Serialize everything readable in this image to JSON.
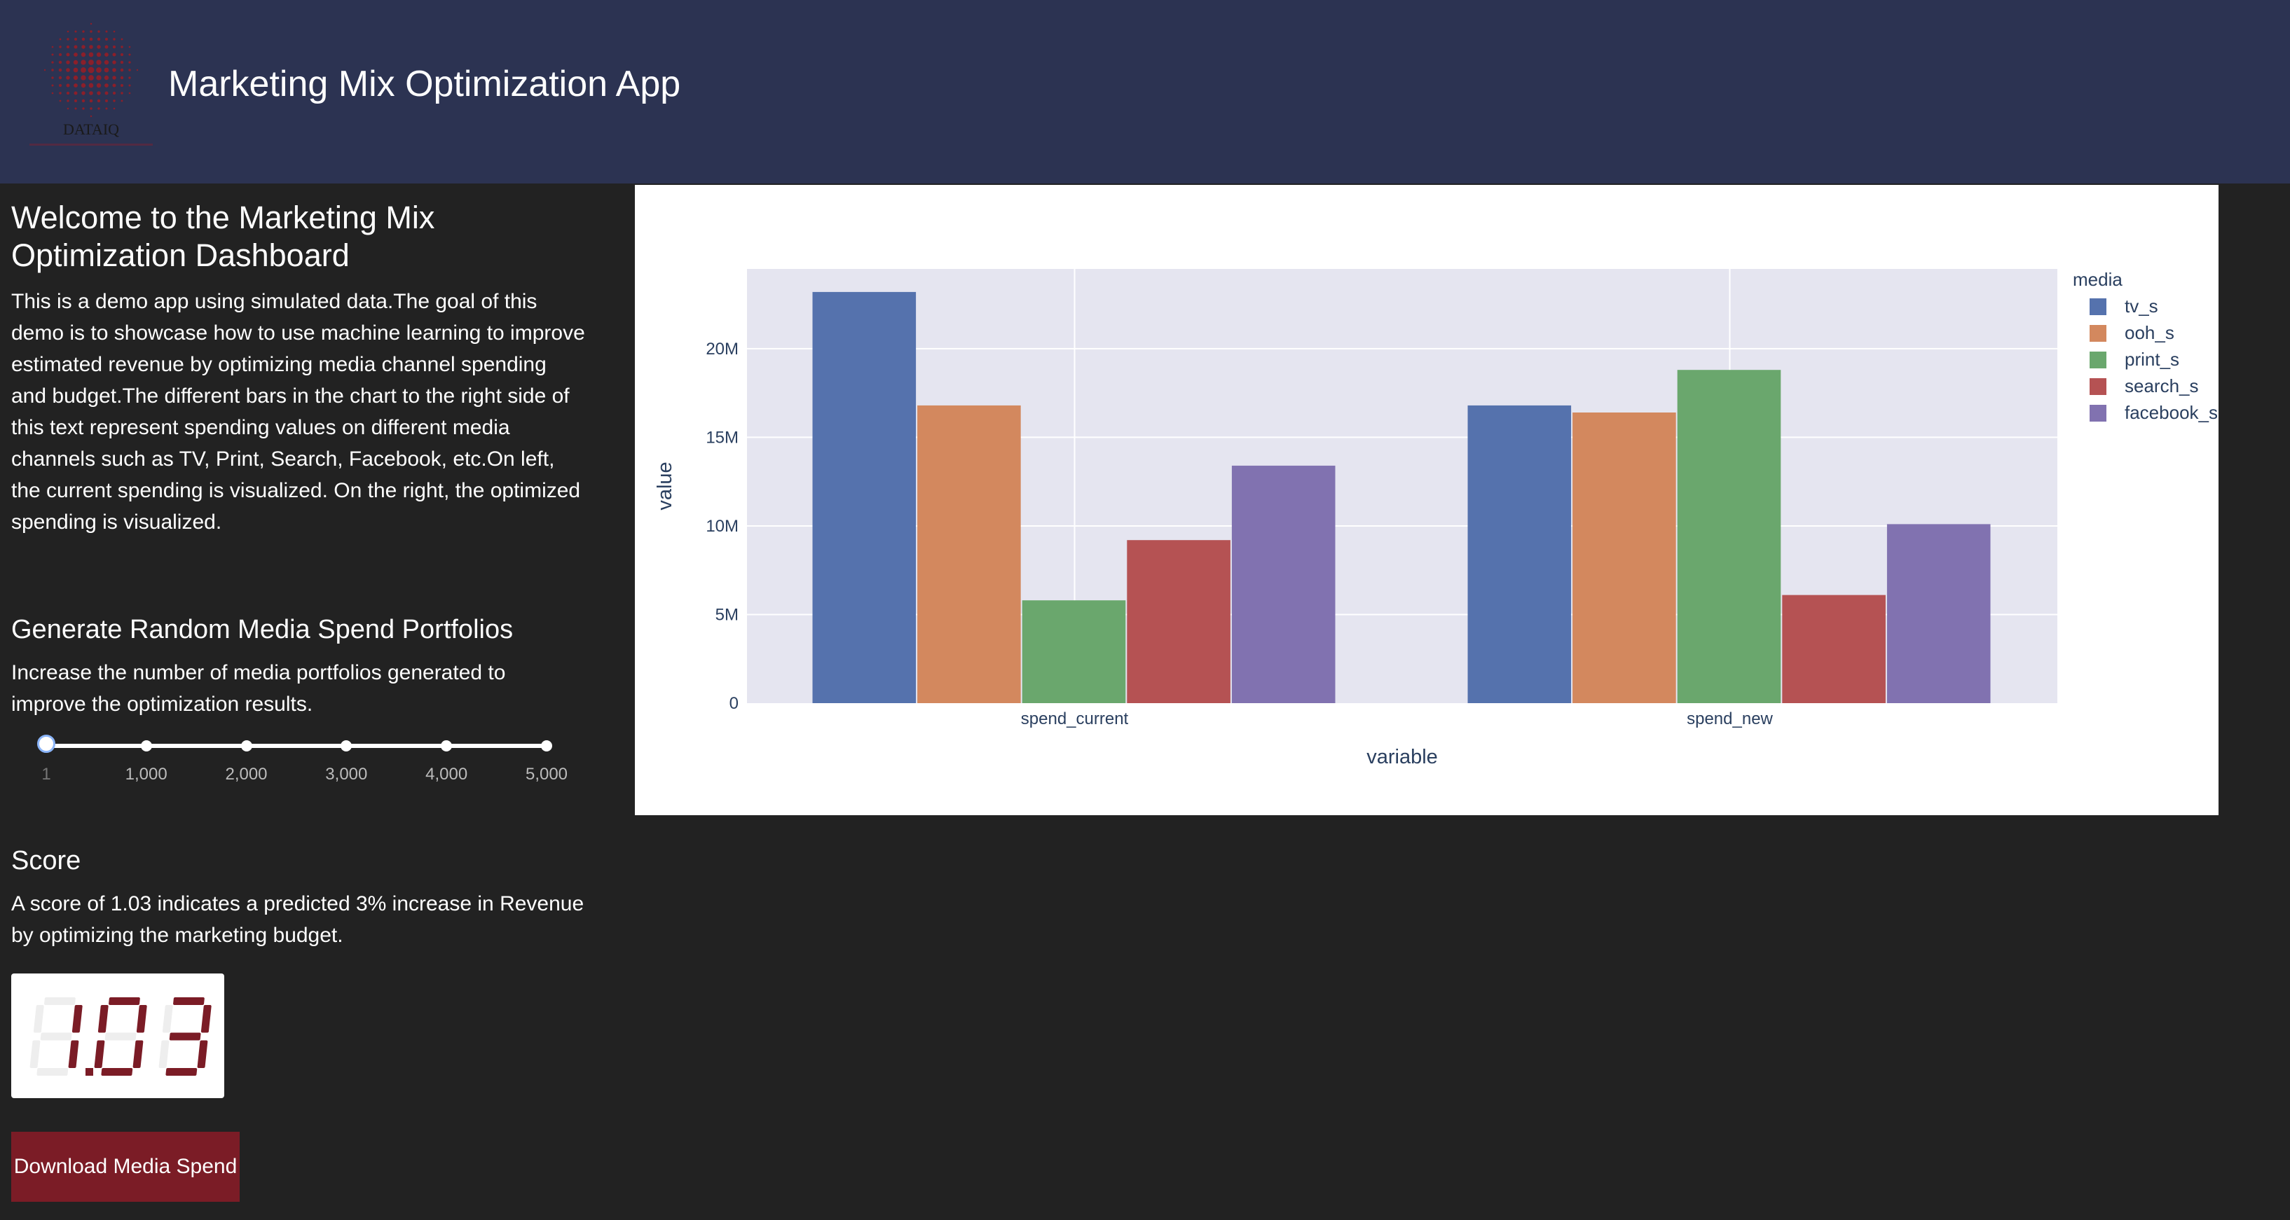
{
  "header": {
    "logo_text": "DATAIQ",
    "title": "Marketing Mix Optimization App"
  },
  "sidebar": {
    "welcome_title": "Welcome to the Marketing Mix Optimization Dashboard",
    "welcome_text": "This is a demo app using simulated data.The goal of this demo is to showcase how to use machine learning to improve estimated revenue by optimizing media channel spending and budget.The different bars in the chart to the right side of this text represent spending values on different media channels such as TV, Print, Search, Facebook, etc.On left, the current spending is visualized. On the right, the optimized spending is visualized.",
    "generate_title": "Generate Random Media Spend Portfolios",
    "generate_text": "Increase the number of media portfolios generated to improve the optimization results.",
    "slider": {
      "value": 1,
      "min": 1,
      "max": 5000,
      "marks": [
        {
          "value": 1,
          "label": "1"
        },
        {
          "value": 1000,
          "label": "1,000"
        },
        {
          "value": 2000,
          "label": "2,000"
        },
        {
          "value": 3000,
          "label": "3,000"
        },
        {
          "value": 4000,
          "label": "4,000"
        },
        {
          "value": 5000,
          "label": "5,000"
        }
      ]
    },
    "score_title": "Score",
    "score_text": "A score of 1.03 indicates a predicted 3% increase in Revenue by optimizing the marketing budget.",
    "score_value": "1.03",
    "download_label": "Download Media Spend"
  },
  "colors": {
    "header_bg": "#2c3352",
    "page_bg": "#222222",
    "accent": "#7b1c26",
    "digit_on": "#7b1c26",
    "digit_off": "#eeeeee"
  },
  "chart_data": {
    "type": "bar",
    "xlabel": "variable",
    "ylabel": "value",
    "legend_title": "media",
    "legend_position": "top-right",
    "ylim": [
      0,
      24500000
    ],
    "yticks": [
      {
        "value": 0,
        "label": "0"
      },
      {
        "value": 5000000,
        "label": "5M"
      },
      {
        "value": 10000000,
        "label": "10M"
      },
      {
        "value": 15000000,
        "label": "15M"
      },
      {
        "value": 20000000,
        "label": "20M"
      }
    ],
    "grid": true,
    "categories": [
      "spend_current",
      "spend_new"
    ],
    "series": [
      {
        "name": "tv_s",
        "color": "#5572ad",
        "values": [
          23200000,
          16800000
        ]
      },
      {
        "name": "ooh_s",
        "color": "#d3885e",
        "values": [
          16800000,
          16400000
        ]
      },
      {
        "name": "print_s",
        "color": "#6aa76d",
        "values": [
          5800000,
          18800000
        ]
      },
      {
        "name": "search_s",
        "color": "#b55253",
        "values": [
          9200000,
          6100000
        ]
      },
      {
        "name": "facebook_s",
        "color": "#8172b0",
        "values": [
          13400000,
          10100000
        ]
      }
    ]
  }
}
